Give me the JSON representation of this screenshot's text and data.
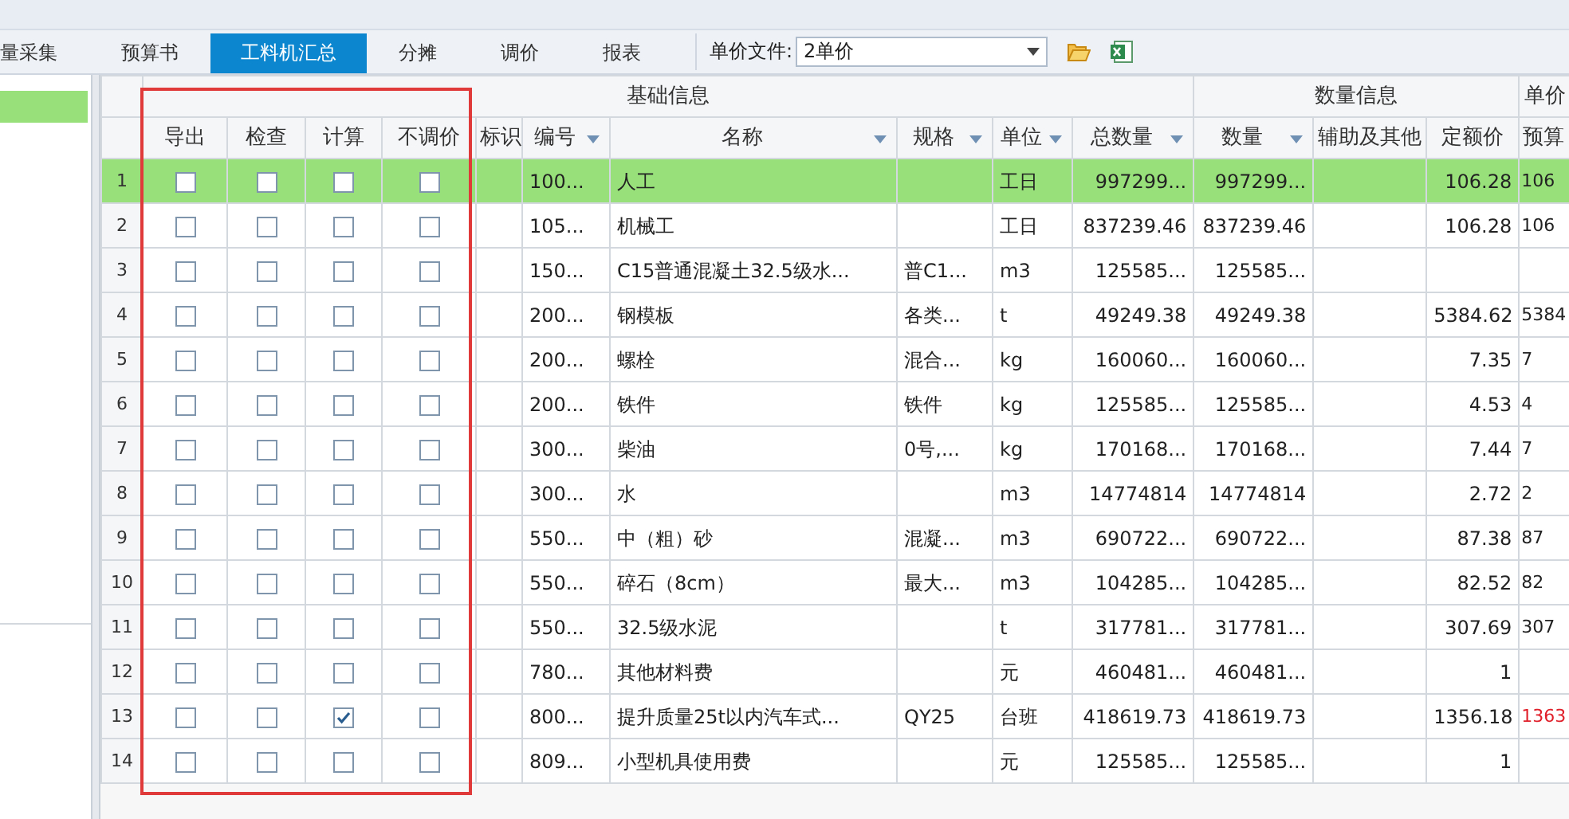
{
  "tabs": [
    {
      "label": "量采集",
      "selected": false
    },
    {
      "label": "预算书",
      "selected": false
    },
    {
      "label": "工料机汇总",
      "selected": true
    },
    {
      "label": "分摊",
      "selected": false
    },
    {
      "label": "调价",
      "selected": false
    },
    {
      "label": "报表",
      "selected": false
    }
  ],
  "price_file": {
    "label": "单价文件:",
    "value": "2单价"
  },
  "sidebar": {
    "items": [
      {
        "selected": true
      }
    ]
  },
  "highlight_frame": true,
  "groups": [
    {
      "label": "基础信息"
    },
    {
      "label": "数量信息"
    },
    {
      "label": "单价"
    }
  ],
  "columns": [
    {
      "label": "导出",
      "filter": false
    },
    {
      "label": "检查",
      "filter": false
    },
    {
      "label": "计算",
      "filter": false
    },
    {
      "label": "不调价",
      "filter": false
    },
    {
      "label": "标识",
      "filter": false
    },
    {
      "label": "编号",
      "filter": true
    },
    {
      "label": "名称",
      "filter": true
    },
    {
      "label": "规格",
      "filter": true
    },
    {
      "label": "单位",
      "filter": true
    },
    {
      "label": "总数量",
      "filter": true
    },
    {
      "label": "数量",
      "filter": true
    },
    {
      "label": "辅助及其他",
      "filter": false
    },
    {
      "label": "定额价",
      "filter": false
    },
    {
      "label": "预算",
      "filter": false
    }
  ],
  "rows": [
    {
      "no": "1",
      "selected": true,
      "export": false,
      "check": false,
      "calc": false,
      "no_adjust": false,
      "code": "100...",
      "name": "人工",
      "unit": "工日",
      "total_qty": "997299...",
      "qty": "997299...",
      "quota_price": "106.28",
      "budget_price": "106",
      "price_changed": false
    },
    {
      "no": "2",
      "selected": false,
      "export": false,
      "check": false,
      "calc": false,
      "no_adjust": false,
      "code": "105...",
      "name": "机械工",
      "unit": "工日",
      "total_qty": "837239.46",
      "qty": "837239.46",
      "quota_price": "106.28",
      "budget_price": "106",
      "price_changed": false
    },
    {
      "no": "3",
      "selected": false,
      "export": false,
      "check": false,
      "calc": false,
      "no_adjust": false,
      "code": "150...",
      "name": "C15普通混凝土32.5级水...",
      "spec": "普C1...",
      "unit": "m3",
      "total_qty": "125585...",
      "qty": "125585...",
      "price_changed": false
    },
    {
      "no": "4",
      "selected": false,
      "export": false,
      "check": false,
      "calc": false,
      "no_adjust": false,
      "code": "200...",
      "name": "钢模板",
      "spec": "各类...",
      "unit": "t",
      "total_qty": "49249.38",
      "qty": "49249.38",
      "quota_price": "5384.62",
      "budget_price": "5384",
      "price_changed": false
    },
    {
      "no": "5",
      "selected": false,
      "export": false,
      "check": false,
      "calc": false,
      "no_adjust": false,
      "code": "200...",
      "name": "螺栓",
      "spec": "混合...",
      "unit": "kg",
      "total_qty": "160060...",
      "qty": "160060...",
      "quota_price": "7.35",
      "budget_price": "7",
      "price_changed": false
    },
    {
      "no": "6",
      "selected": false,
      "export": false,
      "check": false,
      "calc": false,
      "no_adjust": false,
      "code": "200...",
      "name": "铁件",
      "spec": "铁件",
      "unit": "kg",
      "total_qty": "125585...",
      "qty": "125585...",
      "quota_price": "4.53",
      "budget_price": "4",
      "price_changed": false
    },
    {
      "no": "7",
      "selected": false,
      "export": false,
      "check": false,
      "calc": false,
      "no_adjust": false,
      "code": "300...",
      "name": "柴油",
      "spec": "0号,...",
      "unit": "kg",
      "total_qty": "170168...",
      "qty": "170168...",
      "quota_price": "7.44",
      "budget_price": "7",
      "price_changed": false
    },
    {
      "no": "8",
      "selected": false,
      "export": false,
      "check": false,
      "calc": false,
      "no_adjust": false,
      "code": "300...",
      "name": "水",
      "unit": "m3",
      "total_qty": "14774814",
      "qty": "14774814",
      "quota_price": "2.72",
      "budget_price": "2",
      "price_changed": false
    },
    {
      "no": "9",
      "selected": false,
      "export": false,
      "check": false,
      "calc": false,
      "no_adjust": false,
      "code": "550...",
      "name": "中（粗）砂",
      "spec": "混凝...",
      "unit": "m3",
      "total_qty": "690722...",
      "qty": "690722...",
      "quota_price": "87.38",
      "budget_price": "87",
      "price_changed": false
    },
    {
      "no": "10",
      "selected": false,
      "export": false,
      "check": false,
      "calc": false,
      "no_adjust": false,
      "code": "550...",
      "name": "碎石（8cm）",
      "spec": "最大...",
      "unit": "m3",
      "total_qty": "104285...",
      "qty": "104285...",
      "quota_price": "82.52",
      "budget_price": "82",
      "price_changed": false
    },
    {
      "no": "11",
      "selected": false,
      "export": false,
      "check": false,
      "calc": false,
      "no_adjust": false,
      "code": "550...",
      "name": "32.5级水泥",
      "unit": "t",
      "total_qty": "317781...",
      "qty": "317781...",
      "quota_price": "307.69",
      "budget_price": "307",
      "price_changed": false
    },
    {
      "no": "12",
      "selected": false,
      "export": false,
      "check": false,
      "calc": false,
      "no_adjust": false,
      "code": "780...",
      "name": "其他材料费",
      "unit": "元",
      "total_qty": "460481...",
      "qty": "460481...",
      "quota_price": "1",
      "price_changed": false
    },
    {
      "no": "13",
      "selected": false,
      "export": false,
      "check": false,
      "calc": true,
      "no_adjust": false,
      "code": "800...",
      "name": "提升质量25t以内汽车式...",
      "spec": "QY25",
      "unit": "台班",
      "total_qty": "418619.73",
      "qty": "418619.73",
      "quota_price": "1356.18",
      "budget_price": "1363",
      "price_changed": true
    },
    {
      "no": "14",
      "selected": false,
      "export": false,
      "check": false,
      "calc": false,
      "no_adjust": false,
      "code": "809...",
      "name": "小型机具使用费",
      "unit": "元",
      "total_qty": "125585...",
      "qty": "125585...",
      "quota_price": "1",
      "price_changed": false
    }
  ]
}
